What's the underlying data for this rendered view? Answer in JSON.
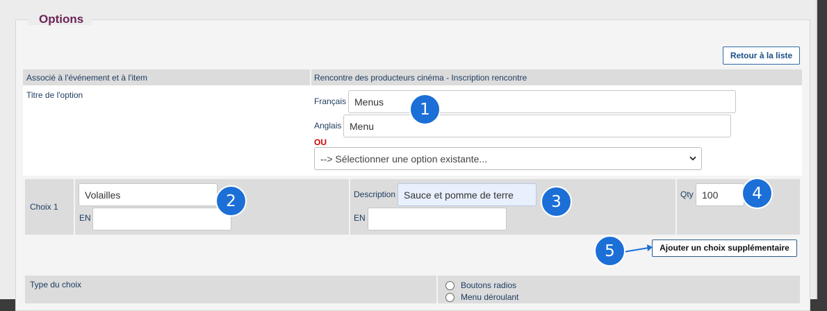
{
  "fieldset": {
    "legend": "Options"
  },
  "buttons": {
    "retour": "Retour à la liste",
    "ajouter": "Ajouter un choix supplémentaire"
  },
  "header_row": {
    "col1": "Associé à l'événement et à l'item",
    "col2": "Rencontre des producteurs cinéma - Inscription rencontre"
  },
  "title_row": {
    "label": "Titre de l'option",
    "fr_label": "Français",
    "fr_value": "Menus",
    "en_label": "Anglais",
    "en_value": "Menu",
    "ou": "OU",
    "select_value": "--> Sélectionner une option existante..."
  },
  "choice": {
    "label": "Choix 1",
    "name_value": "Volailles",
    "name_en_label": "EN",
    "name_en_value": "",
    "desc_label": "Description",
    "desc_value": "Sauce et pomme de terre",
    "desc_en_label": "EN",
    "desc_en_value": "",
    "qty_label": "Qty",
    "qty_value": "100"
  },
  "badges": [
    "1",
    "2",
    "3",
    "4",
    "5"
  ],
  "type_row": {
    "label": "Type du choix",
    "options": [
      "Boutons radios",
      "Menu déroulant"
    ]
  },
  "colors": {
    "legend": "#6b2457",
    "badge": "#1b6fd6",
    "ou": "#d10000",
    "arrow": "#1b6fd6"
  },
  "icons": {
    "select": "chevron-down-icon",
    "arrow": "arrow-right-icon"
  }
}
